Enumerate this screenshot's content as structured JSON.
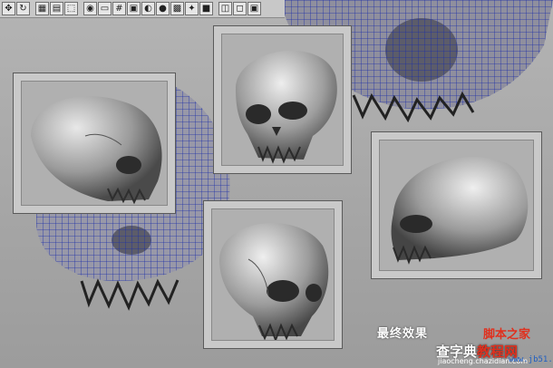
{
  "toolbar": {
    "buttons": [
      {
        "icon": "move-icon",
        "glyph": "✥"
      },
      {
        "icon": "rotate-icon",
        "glyph": "↻"
      },
      {
        "icon": "image-plane-icon",
        "glyph": "▦"
      },
      {
        "icon": "bookmark-icon",
        "glyph": "▤"
      },
      {
        "icon": "wireframe-icon",
        "glyph": "⬚"
      },
      {
        "icon": "camera-icon",
        "glyph": "◉"
      },
      {
        "icon": "film-gate-icon",
        "glyph": "▭"
      },
      {
        "icon": "grid-icon",
        "glyph": "#"
      },
      {
        "icon": "safe-action-icon",
        "glyph": "▣"
      },
      {
        "icon": "shaded-icon",
        "glyph": "◐"
      },
      {
        "icon": "smooth-shade-icon",
        "glyph": "●"
      },
      {
        "icon": "textured-icon",
        "glyph": "▩"
      },
      {
        "icon": "lights-icon",
        "glyph": "✦"
      },
      {
        "icon": "shadows-icon",
        "glyph": "■"
      },
      {
        "icon": "xray-icon",
        "glyph": "◫"
      },
      {
        "icon": "isolate-icon",
        "glyph": "◻"
      },
      {
        "icon": "render-icon",
        "glyph": "▣"
      }
    ]
  },
  "caption": "最终效果",
  "watermark": {
    "site_left": "查字典",
    "site_right": "脚本之家",
    "tutorial": "教程网",
    "subtitle": "jiaocheng.chazidian.com",
    "url": "www.jb51.net"
  },
  "colors": {
    "wire_blue": "#1b2ea8",
    "skull_gray": "#9a9a9a",
    "viewport_bg": "#a9a9a9"
  }
}
